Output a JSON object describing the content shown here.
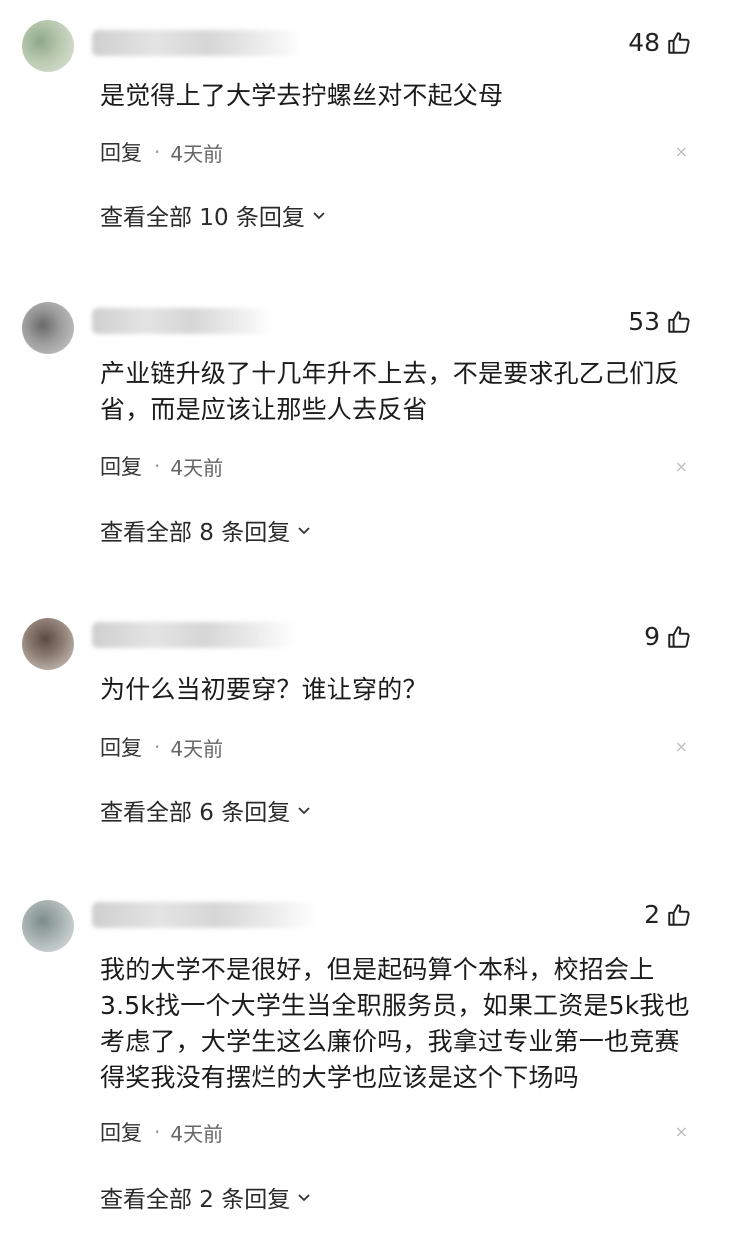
{
  "comments": [
    {
      "likes": "48",
      "text": "是觉得上了大学去拧螺丝对不起父母",
      "reply_label": "回复",
      "dot": "·",
      "time": "4天前",
      "close": "×",
      "view_all": "查看全部 10 条回复"
    },
    {
      "likes": "53",
      "text": "产业链升级了十几年升不上去，不是要求孔乙己们反省，而是应该让那些人去反省",
      "reply_label": "回复",
      "dot": "·",
      "time": "4天前",
      "close": "×",
      "view_all": "查看全部 8 条回复"
    },
    {
      "likes": "9",
      "text": "为什么当初要穿？谁让穿的？",
      "reply_label": "回复",
      "dot": "·",
      "time": "4天前",
      "close": "×",
      "view_all": "查看全部 6 条回复"
    },
    {
      "likes": "2",
      "text": "我的大学不是很好，但是起码算个本科，校招会上3.5k找一个大学生当全职服务员，如果工资是5k我也考虑了，大学生这么廉价吗，我拿过专业第一也竞赛得奖我没有摆烂的大学也应该是这个下场吗",
      "reply_label": "回复",
      "dot": "·",
      "time": "4天前",
      "close": "×",
      "view_all": "查看全部 2 条回复"
    }
  ],
  "icons": {
    "like": "thumbs-up-icon",
    "expand": "chevron-down-icon",
    "dismiss": "close-icon"
  }
}
